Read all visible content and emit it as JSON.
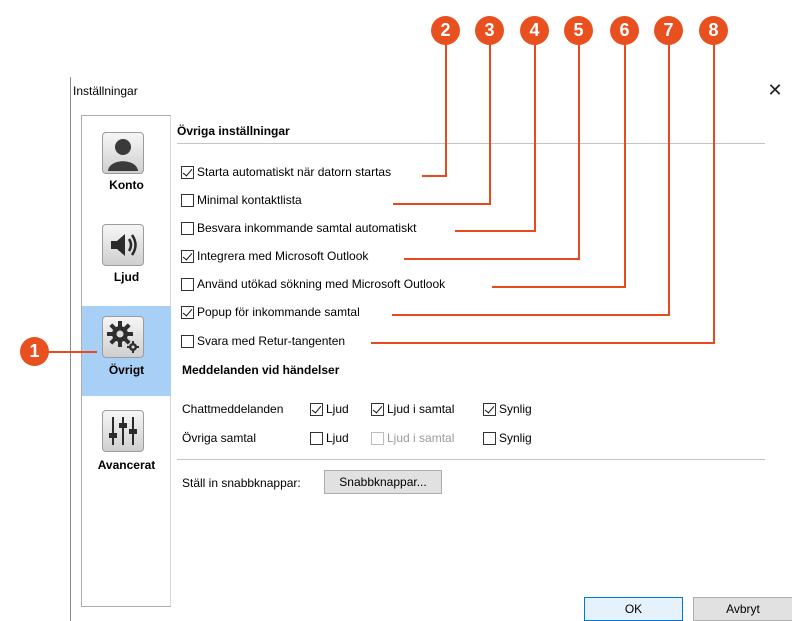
{
  "window": {
    "title": "Inställningar",
    "close_glyph": "✕"
  },
  "sidebar": {
    "items": [
      {
        "label": "Konto",
        "icon": "user-icon",
        "active": false
      },
      {
        "label": "Ljud",
        "icon": "speaker-icon",
        "active": false
      },
      {
        "label": "Övrigt",
        "icon": "gear-icon",
        "active": true
      },
      {
        "label": "Avancerat",
        "icon": "sliders-icon",
        "active": false
      }
    ]
  },
  "other_settings": {
    "title": "Övriga inställningar",
    "options": [
      {
        "label": "Starta automatiskt när datorn startas",
        "checked": true
      },
      {
        "label": "Minimal kontaktlista",
        "checked": false
      },
      {
        "label": "Besvara inkommande samtal automatiskt",
        "checked": false
      },
      {
        "label": "Integrera med Microsoft Outlook",
        "checked": true
      },
      {
        "label": "Använd utökad sökning med Microsoft Outlook",
        "checked": false
      },
      {
        "label": "Popup för inkommande samtal",
        "checked": true
      },
      {
        "label": "Svara med Retur-tangenten",
        "checked": false
      }
    ]
  },
  "notifications": {
    "title": "Meddelanden vid händelser",
    "rows": [
      {
        "label": "Chattmeddelanden",
        "sound": {
          "label": "Ljud",
          "checked": true
        },
        "sound_in_call": {
          "label": "Ljud i samtal",
          "checked": true,
          "disabled": false
        },
        "visible": {
          "label": "Synlig",
          "checked": true
        }
      },
      {
        "label": "Övriga samtal",
        "sound": {
          "label": "Ljud",
          "checked": false
        },
        "sound_in_call": {
          "label": "Ljud i samtal",
          "checked": false,
          "disabled": true
        },
        "visible": {
          "label": "Synlig",
          "checked": false
        }
      }
    ]
  },
  "hotkeys": {
    "label": "Ställ in snabbknappar:",
    "button": "Snabbknappar..."
  },
  "footer": {
    "ok": "OK",
    "cancel": "Avbryt"
  },
  "annotations": {
    "color": "#e8501f",
    "badges": [
      "1",
      "2",
      "3",
      "4",
      "5",
      "6",
      "7",
      "8"
    ]
  }
}
